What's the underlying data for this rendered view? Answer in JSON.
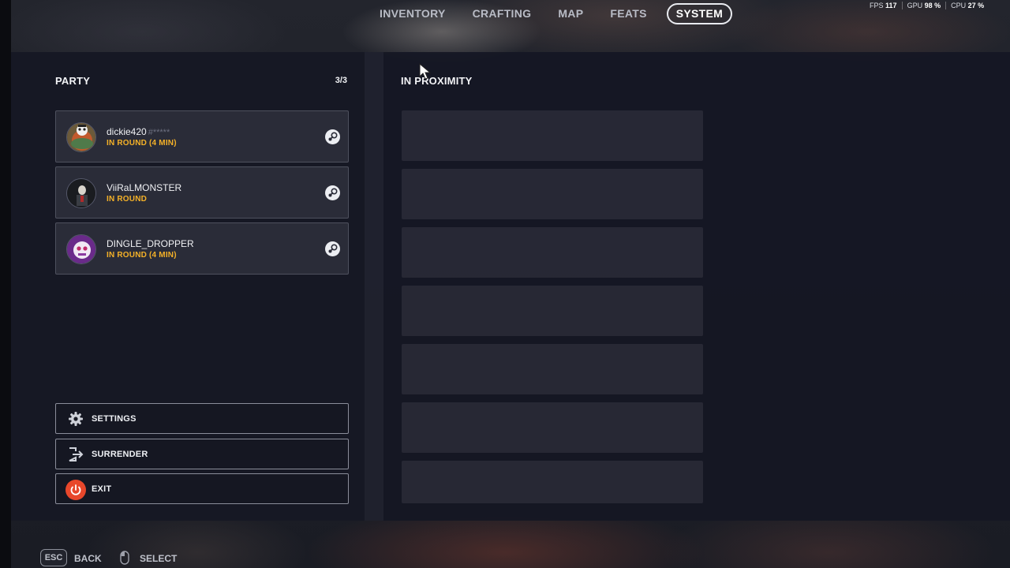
{
  "nav": {
    "tabs": [
      {
        "label": "INVENTORY"
      },
      {
        "label": "CRAFTING"
      },
      {
        "label": "MAP"
      },
      {
        "label": "FEATS"
      },
      {
        "label": "SYSTEM",
        "active": true
      }
    ]
  },
  "stats": {
    "fps_label": "FPS",
    "fps_value": "117",
    "gpu_label": "GPU",
    "gpu_value": "98 %",
    "cpu_label": "CPU",
    "cpu_value": "27 %"
  },
  "party": {
    "title": "PARTY",
    "count": "3/3",
    "members": [
      {
        "name": "dickie420",
        "tag": "#*****",
        "status": "IN ROUND (4 MIN)",
        "platform_icon": "steam-icon"
      },
      {
        "name": "ViiRaLMONSTER",
        "tag": "",
        "status": "IN ROUND",
        "platform_icon": "steam-icon"
      },
      {
        "name": "DINGLE_DROPPER",
        "tag": "",
        "status": "IN ROUND (4 MIN)",
        "platform_icon": "steam-icon"
      }
    ]
  },
  "proximity": {
    "title": "IN PROXIMITY"
  },
  "actions": {
    "settings_label": "SETTINGS",
    "surrender_label": "SURRENDER",
    "exit_label": "EXIT"
  },
  "hints": {
    "esc_key": "ESC",
    "back_label": "BACK",
    "select_label": "SELECT"
  },
  "colors": {
    "status_accent": "#f4b128",
    "exit_accent": "#e8472b"
  }
}
